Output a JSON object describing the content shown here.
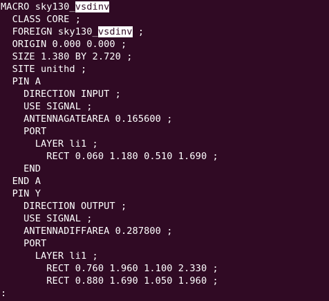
{
  "theme": {
    "background": "#300a24",
    "foreground": "#ffffff",
    "highlight_bg": "#ffffff",
    "highlight_fg": "#300a24"
  },
  "terminal": {
    "lines": [
      {
        "pre": "MACRO sky130_",
        "hl": "vsdinv",
        "post": ""
      },
      {
        "pre": "  CLASS CORE ;",
        "hl": "",
        "post": ""
      },
      {
        "pre": "  FOREIGN sky130_",
        "hl": "vsdinv",
        "post": " ;"
      },
      {
        "pre": "  ORIGIN 0.000 0.000 ;",
        "hl": "",
        "post": ""
      },
      {
        "pre": "  SIZE 1.380 BY 2.720 ;",
        "hl": "",
        "post": ""
      },
      {
        "pre": "  SITE unithd ;",
        "hl": "",
        "post": ""
      },
      {
        "pre": "  PIN A",
        "hl": "",
        "post": ""
      },
      {
        "pre": "    DIRECTION INPUT ;",
        "hl": "",
        "post": ""
      },
      {
        "pre": "    USE SIGNAL ;",
        "hl": "",
        "post": ""
      },
      {
        "pre": "    ANTENNAGATEAREA 0.165600 ;",
        "hl": "",
        "post": ""
      },
      {
        "pre": "    PORT",
        "hl": "",
        "post": ""
      },
      {
        "pre": "      LAYER li1 ;",
        "hl": "",
        "post": ""
      },
      {
        "pre": "        RECT 0.060 1.180 0.510 1.690 ;",
        "hl": "",
        "post": ""
      },
      {
        "pre": "    END",
        "hl": "",
        "post": ""
      },
      {
        "pre": "  END A",
        "hl": "",
        "post": ""
      },
      {
        "pre": "  PIN Y",
        "hl": "",
        "post": ""
      },
      {
        "pre": "    DIRECTION OUTPUT ;",
        "hl": "",
        "post": ""
      },
      {
        "pre": "    USE SIGNAL ;",
        "hl": "",
        "post": ""
      },
      {
        "pre": "    ANTENNADIFFAREA 0.287800 ;",
        "hl": "",
        "post": ""
      },
      {
        "pre": "    PORT",
        "hl": "",
        "post": ""
      },
      {
        "pre": "      LAYER li1 ;",
        "hl": "",
        "post": ""
      },
      {
        "pre": "        RECT 0.760 1.960 1.100 2.330 ;",
        "hl": "",
        "post": ""
      },
      {
        "pre": "        RECT 0.880 1.690 1.050 1.960 ;",
        "hl": "",
        "post": ""
      },
      {
        "pre": ":",
        "hl": "",
        "post": ""
      }
    ]
  }
}
